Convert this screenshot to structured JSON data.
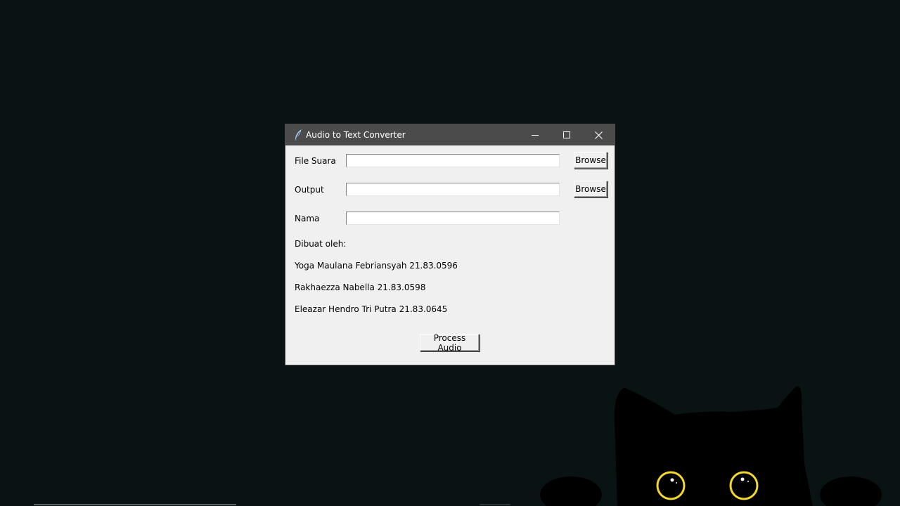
{
  "window": {
    "title": "Audio to Text Converter",
    "app_icon": "feather-icon",
    "controls": [
      "minimize-icon",
      "maximize-icon",
      "close-icon"
    ]
  },
  "form": {
    "fields": [
      {
        "label": "File Suara",
        "value": "",
        "browse_label": "Browse"
      },
      {
        "label": "Output",
        "value": "",
        "browse_label": "Browse"
      },
      {
        "label": "Nama",
        "value": ""
      }
    ]
  },
  "credits": {
    "heading": "Dibuat oleh:",
    "authors": [
      "Yoga Maulana Febriansyah 21.83.0596",
      "Rakhaezza Nabella 21.83.0598",
      "Eleazar Hendro Tri Putra 21.83.0645"
    ]
  },
  "actions": {
    "process_label": "Process Audio"
  },
  "colors": {
    "desktop_background": "#0a1314",
    "titlebar": "#4b4b4b",
    "window_body": "#f0f0f0",
    "cat_eye": "#f2d72c"
  }
}
